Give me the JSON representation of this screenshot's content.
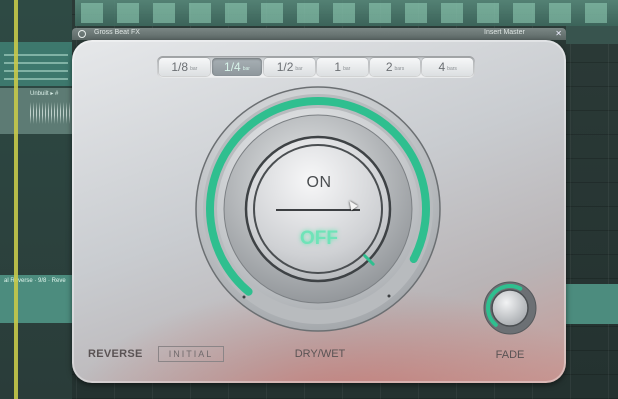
{
  "plugin": {
    "title": "Gross Beat FX",
    "title_right": "Insert Master"
  },
  "rates": {
    "items": [
      {
        "value": "1/8",
        "unit": "bar"
      },
      {
        "value": "1/4",
        "unit": "bar"
      },
      {
        "value": "1/2",
        "unit": "bar"
      },
      {
        "value": "1",
        "unit": "bar"
      },
      {
        "value": "2",
        "unit": "bars"
      },
      {
        "value": "4",
        "unit": "bars"
      }
    ],
    "active_index": 1
  },
  "switch": {
    "on_label": "ON",
    "off_label": "OFF"
  },
  "dry_wet": {
    "label": "DRY/WET",
    "value": 0.92
  },
  "reverse": {
    "label": "REVERSE",
    "mode": "INITIAL"
  },
  "fade": {
    "label": "FADE",
    "value": 0.6
  },
  "daw": {
    "clip_labels": [
      "Unbuilt ▸ #",
      "al Reverse · 9/8 · Reve"
    ]
  },
  "colors": {
    "accent": "#2fbf8f",
    "glow": "#6fe3b8"
  },
  "icons": {
    "close": "close-icon",
    "menu": "menu-icon"
  }
}
